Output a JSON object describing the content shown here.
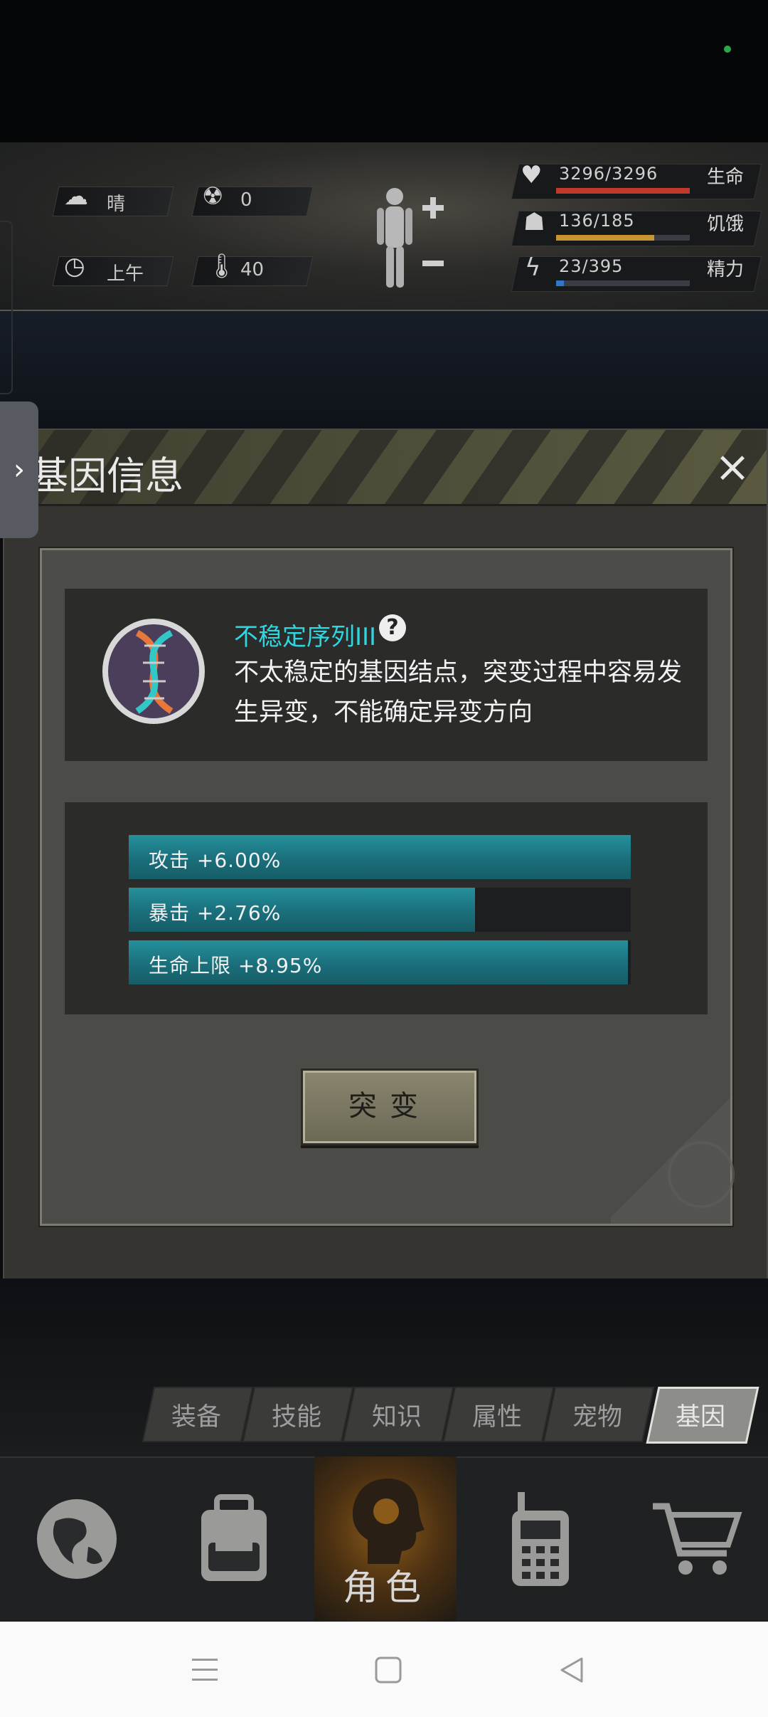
{
  "hud": {
    "weather": "晴",
    "radiation": "0",
    "time_of_day": "上午",
    "temperature": "40",
    "stats": [
      {
        "name": "生命",
        "value": "3296/3296",
        "fill": 1.0,
        "color": "#c0392b",
        "icon": "heart-icon"
      },
      {
        "name": "饥饿",
        "value": "136/185",
        "fill": 0.735,
        "color": "#c89430",
        "icon": "stomach-icon"
      },
      {
        "name": "精力",
        "value": "23/395",
        "fill": 0.058,
        "color": "#2f78c8",
        "icon": "energy-icon"
      }
    ]
  },
  "dialog": {
    "title": "基因信息",
    "close_icon": "×",
    "gene_name": "不稳定序列III",
    "help_icon": "?",
    "gene_description": "不太稳定的基因结点，突变过程中容易发生异变，不能确定异变方向",
    "stats": [
      {
        "label": "攻击 +6.00%",
        "fill": 1.0
      },
      {
        "label": "暴击 +2.76%",
        "fill": 0.69
      },
      {
        "label": "生命上限 +8.95%",
        "fill": 0.995
      }
    ],
    "mutate_button": "突变"
  },
  "tabs": [
    "装备",
    "技能",
    "知识",
    "属性",
    "宠物",
    "基因"
  ],
  "active_tab": "基因",
  "bottom_nav": {
    "items": [
      "world-map-icon",
      "backpack-icon",
      "character-icon",
      "radio-icon",
      "shop-cart-icon"
    ],
    "active_label": "角色"
  },
  "colors": {
    "accent_cyan": "#2fd6e0",
    "bar_teal": "#1a6f7b",
    "hazard_yellow": "#6b6a4a"
  }
}
